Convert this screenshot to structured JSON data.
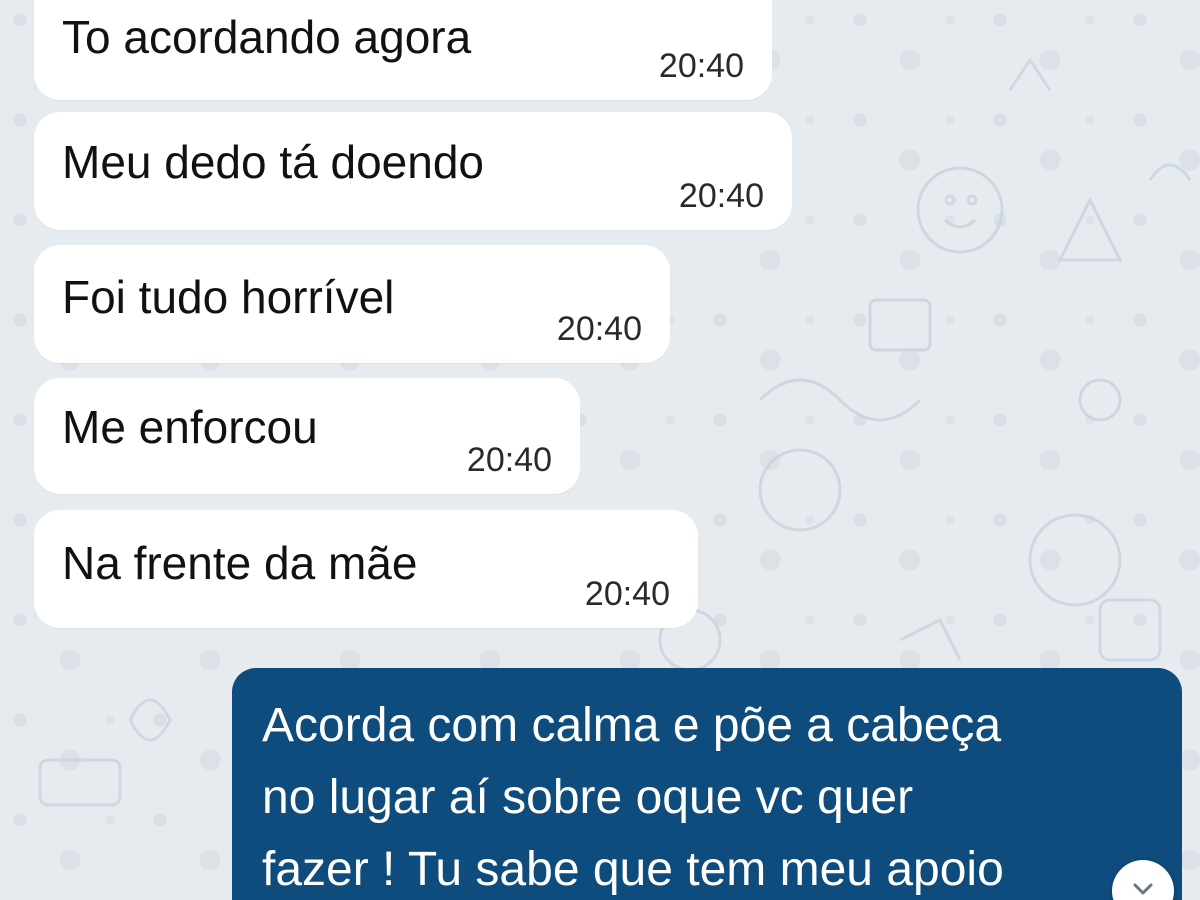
{
  "chat": {
    "received": [
      {
        "text": "To acordando agora",
        "time": "20:40"
      },
      {
        "text": "Meu dedo tá doendo",
        "time": "20:40"
      },
      {
        "text": "Foi tudo horrível",
        "time": "20:40"
      },
      {
        "text": "Me enforcou",
        "time": "20:40"
      },
      {
        "text": "Na frente da mãe",
        "time": "20:40"
      }
    ],
    "sent": {
      "lines": [
        "Acorda com calma e põe a cabeça",
        "no lugar aí sobre oque vc quer",
        "fazer ! Tu sabe que tem meu apoio"
      ]
    }
  },
  "icons": {
    "scroll_down": "chevron-down-icon"
  },
  "colors": {
    "received_bubble": "#ffffff",
    "sent_bubble": "#0d4c7c",
    "background": "#e6ebf0"
  }
}
